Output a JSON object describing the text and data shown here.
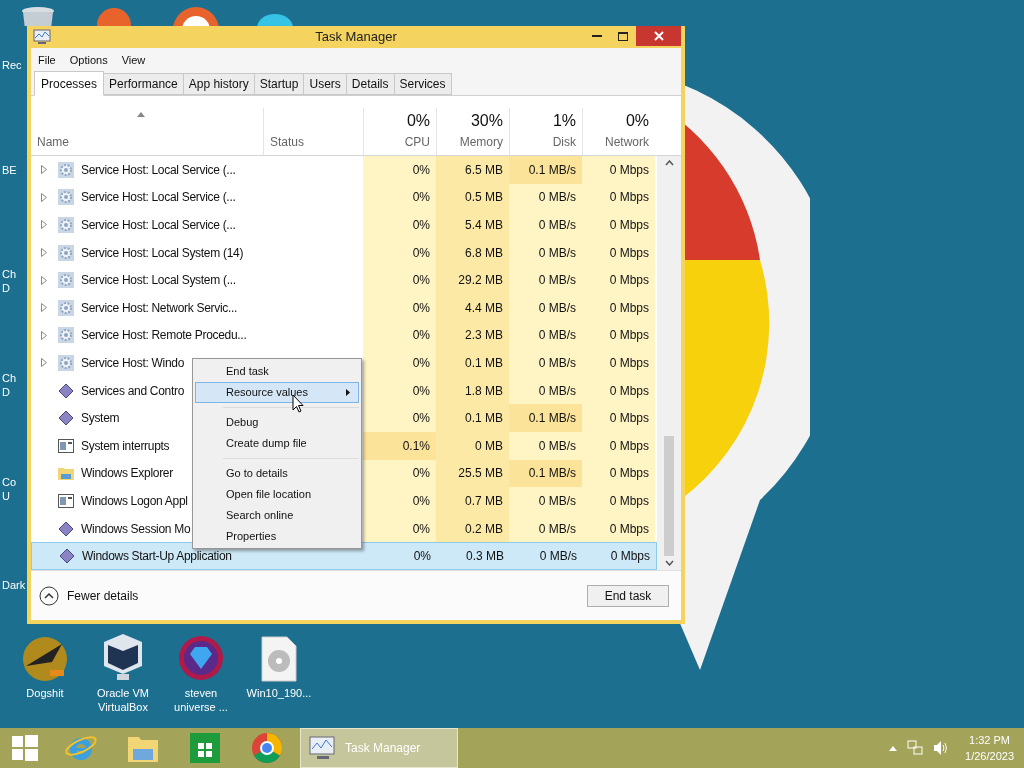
{
  "window": {
    "title": "Task Manager"
  },
  "menu": [
    "File",
    "Options",
    "View"
  ],
  "tabs": [
    {
      "label": "Processes",
      "selected": true
    },
    {
      "label": "Performance",
      "selected": false
    },
    {
      "label": "App history",
      "selected": false
    },
    {
      "label": "Startup",
      "selected": false
    },
    {
      "label": "Users",
      "selected": false
    },
    {
      "label": "Details",
      "selected": false
    },
    {
      "label": "Services",
      "selected": false
    }
  ],
  "columns": [
    {
      "label": "Name"
    },
    {
      "label": "Status"
    },
    {
      "label": "CPU",
      "total": "0%"
    },
    {
      "label": "Memory",
      "total": "30%"
    },
    {
      "label": "Disk",
      "total": "1%"
    },
    {
      "label": "Network",
      "total": "0%"
    }
  ],
  "rows": [
    {
      "name": "Service Host: Local Service (...",
      "kind": "service",
      "expandable": true,
      "cpu": "0%",
      "memory": "6.5 MB",
      "disk": "0.1 MB/s",
      "network": "0 Mbps",
      "cpu_busy": false,
      "disk_busy": true,
      "selected": false
    },
    {
      "name": "Service Host: Local Service (...",
      "kind": "service",
      "expandable": true,
      "cpu": "0%",
      "memory": "0.5 MB",
      "disk": "0 MB/s",
      "network": "0 Mbps",
      "cpu_busy": false,
      "disk_busy": false,
      "selected": false
    },
    {
      "name": "Service Host: Local Service (...",
      "kind": "service",
      "expandable": true,
      "cpu": "0%",
      "memory": "5.4 MB",
      "disk": "0 MB/s",
      "network": "0 Mbps",
      "cpu_busy": false,
      "disk_busy": false,
      "selected": false
    },
    {
      "name": "Service Host: Local System (14)",
      "kind": "service",
      "expandable": true,
      "cpu": "0%",
      "memory": "6.8 MB",
      "disk": "0 MB/s",
      "network": "0 Mbps",
      "cpu_busy": false,
      "disk_busy": false,
      "selected": false
    },
    {
      "name": "Service Host: Local System (...",
      "kind": "service",
      "expandable": true,
      "cpu": "0%",
      "memory": "29.2 MB",
      "disk": "0 MB/s",
      "network": "0 Mbps",
      "cpu_busy": false,
      "disk_busy": false,
      "selected": false
    },
    {
      "name": "Service Host: Network Servic...",
      "kind": "service",
      "expandable": true,
      "cpu": "0%",
      "memory": "4.4 MB",
      "disk": "0 MB/s",
      "network": "0 Mbps",
      "cpu_busy": false,
      "disk_busy": false,
      "selected": false
    },
    {
      "name": "Service Host: Remote Procedu...",
      "kind": "service",
      "expandable": true,
      "cpu": "0%",
      "memory": "2.3 MB",
      "disk": "0 MB/s",
      "network": "0 Mbps",
      "cpu_busy": false,
      "disk_busy": false,
      "selected": false
    },
    {
      "name": "Service Host: Windo",
      "kind": "service",
      "expandable": true,
      "cpu": "0%",
      "memory": "0.1 MB",
      "disk": "0 MB/s",
      "network": "0 Mbps",
      "cpu_busy": false,
      "disk_busy": false,
      "selected": false
    },
    {
      "name": "Services and Contro",
      "kind": "system",
      "expandable": false,
      "cpu": "0%",
      "memory": "1.8 MB",
      "disk": "0 MB/s",
      "network": "0 Mbps",
      "cpu_busy": false,
      "disk_busy": false,
      "selected": false
    },
    {
      "name": "System",
      "kind": "system",
      "expandable": false,
      "cpu": "0%",
      "memory": "0.1 MB",
      "disk": "0.1 MB/s",
      "network": "0 Mbps",
      "cpu_busy": false,
      "disk_busy": true,
      "selected": false
    },
    {
      "name": "System interrupts",
      "kind": "window",
      "expandable": false,
      "cpu": "0.1%",
      "memory": "0 MB",
      "disk": "0 MB/s",
      "network": "0 Mbps",
      "cpu_busy": true,
      "disk_busy": false,
      "selected": false
    },
    {
      "name": "Windows Explorer",
      "kind": "folder",
      "expandable": false,
      "cpu": "0%",
      "memory": "25.5 MB",
      "disk": "0.1 MB/s",
      "network": "0 Mbps",
      "cpu_busy": false,
      "disk_busy": true,
      "selected": false
    },
    {
      "name": "Windows Logon Appl",
      "kind": "window",
      "expandable": false,
      "cpu": "0%",
      "memory": "0.7 MB",
      "disk": "0 MB/s",
      "network": "0 Mbps",
      "cpu_busy": false,
      "disk_busy": false,
      "selected": false
    },
    {
      "name": "Windows Session Mo",
      "kind": "system",
      "expandable": false,
      "cpu": "0%",
      "memory": "0.2 MB",
      "disk": "0 MB/s",
      "network": "0 Mbps",
      "cpu_busy": false,
      "disk_busy": false,
      "selected": false
    },
    {
      "name": "Windows Start-Up Application",
      "kind": "system",
      "expandable": false,
      "cpu": "0%",
      "memory": "0.3 MB",
      "disk": "0 MB/s",
      "network": "0 Mbps",
      "cpu_busy": false,
      "disk_busy": false,
      "selected": true
    }
  ],
  "context_menu": [
    {
      "label": "End task",
      "submenu": false,
      "selected": false,
      "separator_before": false
    },
    {
      "label": "Resource values",
      "submenu": true,
      "selected": true,
      "separator_before": false
    },
    {
      "label": "Debug",
      "submenu": false,
      "selected": false,
      "separator_before": true
    },
    {
      "label": "Create dump file",
      "submenu": false,
      "selected": false,
      "separator_before": false
    },
    {
      "label": "Go to details",
      "submenu": false,
      "selected": false,
      "separator_before": true
    },
    {
      "label": "Open file location",
      "submenu": false,
      "selected": false,
      "separator_before": false
    },
    {
      "label": "Search online",
      "submenu": false,
      "selected": false,
      "separator_before": false
    },
    {
      "label": "Properties",
      "submenu": false,
      "selected": false,
      "separator_before": false
    }
  ],
  "footer": {
    "toggle": "Fewer details",
    "button": "End task"
  },
  "desktop_side_labels": [
    "Rec",
    "BE",
    "Ch D",
    "Ch D",
    "Co U",
    "Dark"
  ],
  "desktop_icons": [
    {
      "label": "Dogshit",
      "kind": "app"
    },
    {
      "label": "Oracle VM VirtualBox",
      "kind": "box"
    },
    {
      "label": "steven universe ...",
      "kind": "gem"
    },
    {
      "label": "Win10_190...",
      "kind": "disc"
    }
  ],
  "taskbar": {
    "apps": [
      {
        "kind": "ie"
      },
      {
        "kind": "explorer"
      },
      {
        "kind": "store"
      },
      {
        "kind": "chrome"
      }
    ],
    "window_button": {
      "label": "Task Manager",
      "selected": true
    },
    "time": "1:32 PM",
    "date": "1/26/2023"
  }
}
